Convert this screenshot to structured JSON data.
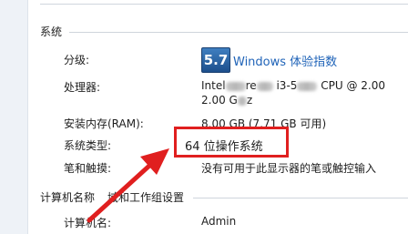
{
  "system": {
    "title": "系统",
    "rating": {
      "label": "分级:",
      "score": "5.7",
      "link": "Windows 体验指数"
    },
    "processor": {
      "label": "处理器:",
      "prefix": "Intel",
      "middle": "re",
      "model": "i3-5",
      "suffix": "CPU @ 2.00",
      "line2_prefix": "2.00 G",
      "line2_suffix": "z"
    },
    "ram": {
      "label": "安装内存(RAM):",
      "value": "8.00 GB (7.71 GB 可用)"
    },
    "type": {
      "label": "系统类型:",
      "value": "64 位操作系统"
    },
    "pen": {
      "label": "笔和触摸:",
      "value": "没有可用于此显示器的笔或触控输入"
    }
  },
  "computer": {
    "title_left": "计算机名称",
    "title_right": "域和工作组设置",
    "name": {
      "label": "计算机名:",
      "value": "Admin"
    }
  },
  "colors": {
    "highlight": "#e01f1f",
    "link": "#1f63b8"
  }
}
